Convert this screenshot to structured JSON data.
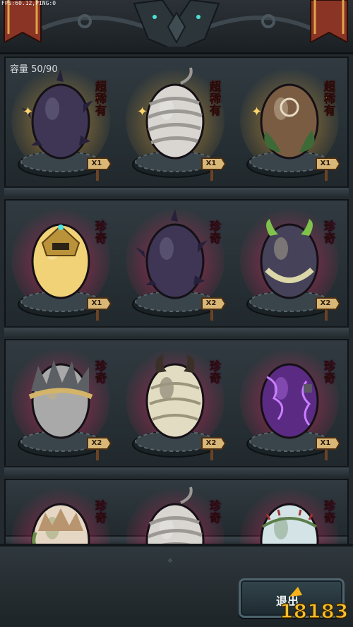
{
  "debug": {
    "fps_text": "FPS:60.12,PING:0"
  },
  "inventory": {
    "capacity_label": "容量 50/90"
  },
  "eggs": [
    {
      "name": "dark-spike-egg",
      "rarity": "超稀有",
      "rarity_tier": "legend",
      "count": "X1"
    },
    {
      "name": "wrapped-egg",
      "rarity": "超稀有",
      "rarity_tier": "legend",
      "count": "X1"
    },
    {
      "name": "leaf-rune-egg",
      "rarity": "超稀有",
      "rarity_tier": "legend",
      "count": "X1"
    },
    {
      "name": "golden-helmet-egg",
      "rarity": "珍奇",
      "rarity_tier": "rare",
      "count": "X1"
    },
    {
      "name": "dark-spike-egg",
      "rarity": "珍奇",
      "rarity_tier": "rare",
      "count": "X2"
    },
    {
      "name": "horned-dark-egg",
      "rarity": "珍奇",
      "rarity_tier": "rare",
      "count": "X2"
    },
    {
      "name": "furry-gray-egg",
      "rarity": "珍奇",
      "rarity_tier": "rare",
      "count": "X2"
    },
    {
      "name": "armored-bone-egg",
      "rarity": "珍奇",
      "rarity_tier": "rare",
      "count": "X2"
    },
    {
      "name": "purple-shadow-egg",
      "rarity": "珍奇",
      "rarity_tier": "rare",
      "count": "X1"
    },
    {
      "name": "bone-crown-egg",
      "rarity": "珍奇",
      "rarity_tier": "rare",
      "count": ""
    },
    {
      "name": "wrapped-egg",
      "rarity": "珍奇",
      "rarity_tier": "rare",
      "count": ""
    },
    {
      "name": "thorn-white-egg",
      "rarity": "珍奇",
      "rarity_tier": "rare",
      "count": ""
    }
  ],
  "footer": {
    "exit_label": "退出"
  },
  "watermark": {
    "text": "18183"
  },
  "colors": {
    "legend": "#ffb42a",
    "rare": "#ff4cff",
    "panel": "#232b30"
  }
}
